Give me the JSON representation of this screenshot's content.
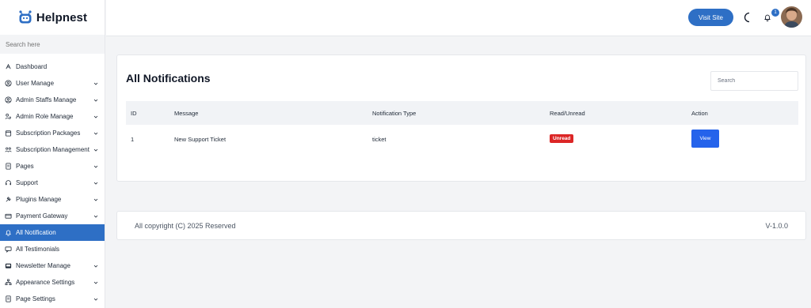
{
  "brand": {
    "name": "Helpnest"
  },
  "sidebar": {
    "search_placeholder": "Search here",
    "items": [
      {
        "label": "Dashboard",
        "icon": "dashboard-icon",
        "caret": false,
        "active": false
      },
      {
        "label": "User Manage",
        "icon": "user-icon",
        "caret": true,
        "active": false
      },
      {
        "label": "Admin Staffs Manage",
        "icon": "user-circle-icon",
        "caret": true,
        "active": false
      },
      {
        "label": "Admin Role Manage",
        "icon": "user-key-icon",
        "caret": true,
        "active": false
      },
      {
        "label": "Subscription Packages",
        "icon": "calendar-icon",
        "caret": true,
        "active": false
      },
      {
        "label": "Subscription Management",
        "icon": "users-icon",
        "caret": true,
        "active": false
      },
      {
        "label": "Pages",
        "icon": "page-icon",
        "caret": true,
        "active": false
      },
      {
        "label": "Support",
        "icon": "headset-icon",
        "caret": true,
        "active": false
      },
      {
        "label": "Plugins Manage",
        "icon": "plug-icon",
        "caret": true,
        "active": false
      },
      {
        "label": "Payment Gateway",
        "icon": "card-icon",
        "caret": true,
        "active": false
      },
      {
        "label": "All Notification",
        "icon": "bell-icon",
        "caret": false,
        "active": true
      },
      {
        "label": "All Testimonials",
        "icon": "comment-icon",
        "caret": false,
        "active": false
      },
      {
        "label": "Newsletter Manage",
        "icon": "inbox-icon",
        "caret": true,
        "active": false
      },
      {
        "label": "Appearance Settings",
        "icon": "sitemap-icon",
        "caret": true,
        "active": false
      },
      {
        "label": "Page Settings",
        "icon": "page-settings-icon",
        "caret": true,
        "active": false
      }
    ]
  },
  "topbar": {
    "visit_site_label": "Visit Site",
    "notification_count": "1",
    "icons": [
      "moon-icon",
      "bell-icon",
      "avatar"
    ]
  },
  "main": {
    "title": "All Notifications",
    "search_placeholder": "Search",
    "table": {
      "columns": [
        "ID",
        "Message",
        "Notification Type",
        "Read/Unread",
        "Action"
      ],
      "rows": [
        {
          "id": "1",
          "message": "New Support Ticket",
          "type": "ticket",
          "status": "Unread",
          "action": "View"
        }
      ]
    }
  },
  "footer": {
    "copyright": "All copyright (C) 2025 Reserved",
    "version": "V-1.0.0"
  },
  "colors": {
    "primary": "#2e6fc5",
    "button_blue": "#2563eb",
    "unread_red": "#dc2626",
    "background": "#f3f4f6"
  }
}
